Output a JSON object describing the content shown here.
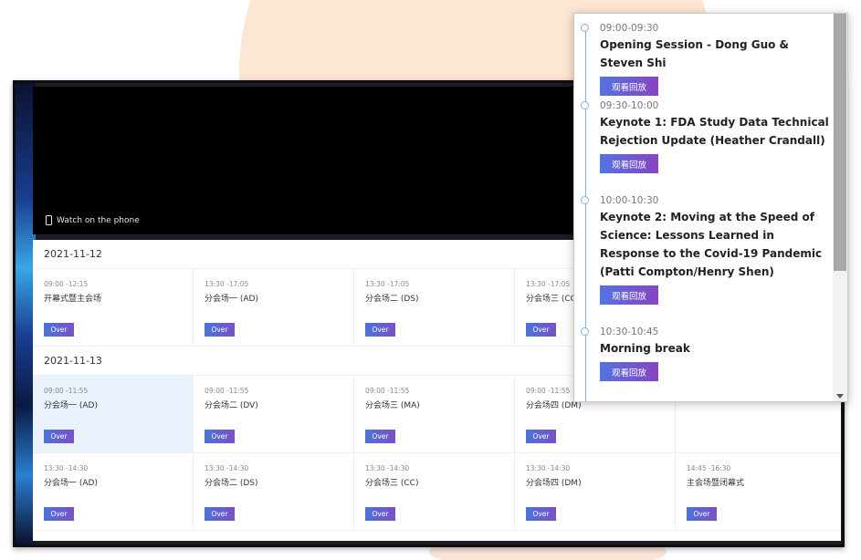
{
  "video": {
    "watch_on_phone": "Watch on the phone"
  },
  "schedule": {
    "days": [
      {
        "date": "2021-11-12",
        "rows": [
          [
            {
              "time": "09:00 -12:15",
              "name": "开幕式暨主会场",
              "status": "Over"
            },
            {
              "time": "13:30 -17:05",
              "name": "分会场一 (AD)",
              "status": "Over"
            },
            {
              "time": "13:30 -17:05",
              "name": "分会场二 (DS)",
              "status": "Over"
            },
            {
              "time": "13:30 -17:05",
              "name": "分会场三 (CC)",
              "status": "Over"
            }
          ]
        ]
      },
      {
        "date": "2021-11-13",
        "rows": [
          [
            {
              "time": "09:00 -11:55",
              "name": "分会场一 (AD)",
              "status": "Over"
            },
            {
              "time": "09:00 -11:55",
              "name": "分会场二 (DV)",
              "status": "Over"
            },
            {
              "time": "09:00 -11:55",
              "name": "分会场三 (MA)",
              "status": "Over"
            },
            {
              "time": "09:00 -11:55",
              "name": "分会场四 (DM)",
              "status": "Over"
            }
          ],
          [
            {
              "time": "13:30 -14:30",
              "name": "分会场一 (AD)",
              "status": "Over"
            },
            {
              "time": "13:30 -14:30",
              "name": "分会场二 (DS)",
              "status": "Over"
            },
            {
              "time": "13:30 -14:30",
              "name": "分会场三 (CC)",
              "status": "Over"
            },
            {
              "time": "13:30 -14:30",
              "name": "分会场四 (DM)",
              "status": "Over"
            },
            {
              "time": "14:45 -16:30",
              "name": "主会场暨闭幕式",
              "status": "Over"
            }
          ]
        ]
      }
    ]
  },
  "popup": {
    "entries": [
      {
        "time": "09:00-09:30",
        "title": "Opening Session - Dong Guo & Steven Shi",
        "button": "观看回放"
      },
      {
        "time": "09:30-10:00",
        "title": "Keynote 1: FDA Study Data Technical Rejection Update (Heather Crandall)",
        "button": "观看回放"
      },
      {
        "time": "10:00-10:30",
        "title": "Keynote 2: Moving at the Speed of Science: Lessons Learned in Response to the Covid-19 Pandemic (Patti Compton/Henry Shen)",
        "button": "观看回放"
      },
      {
        "time": "10:30-10:45",
        "title": "Morning break",
        "button": "观看回放"
      }
    ]
  },
  "colors": {
    "accent_gradient_start": "#4a74d6",
    "accent_gradient_end": "#7b4fc7",
    "timeline": "#7fb2e6",
    "background_circle": "#fde6d2"
  }
}
